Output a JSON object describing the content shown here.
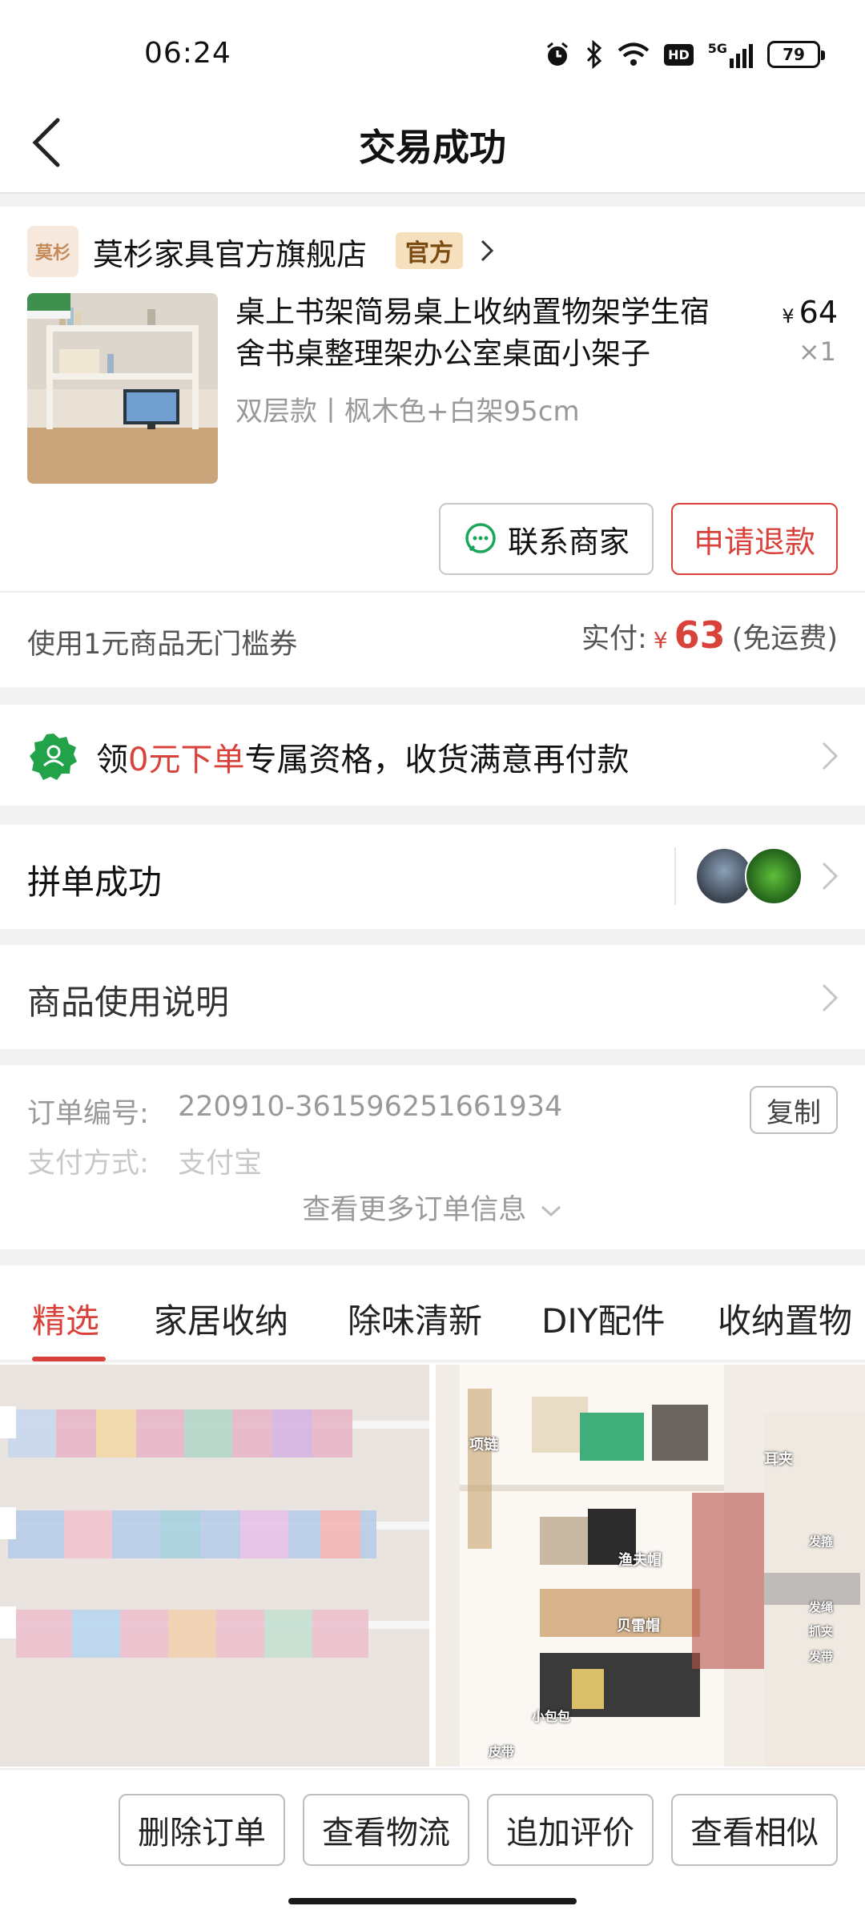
{
  "status_bar": {
    "time": "06:24",
    "battery": "79",
    "network": "5G",
    "hd": "HD"
  },
  "header": {
    "title": "交易成功"
  },
  "shop": {
    "logo_text": "莫杉",
    "name": "莫杉家具官方旗舰店",
    "badge": "官方"
  },
  "product": {
    "title": "桌上书架简易桌上收纳置物架学生宿舍书桌整理架办公室桌面小架子",
    "spec": "双层款丨枫木色+白架95cm",
    "currency": "¥",
    "price": "64",
    "qty": "×1"
  },
  "actions": {
    "contact": "联系商家",
    "refund": "申请退款"
  },
  "payment": {
    "coupon": "使用1元商品无门槛券",
    "paid_label": "实付:",
    "currency": "¥",
    "amount": "63",
    "shipping": "(免运费)"
  },
  "promo": {
    "prefix": "领",
    "highlight": "0元下单",
    "suffix": "专属资格，收货满意再付款"
  },
  "group": {
    "label": "拼单成功"
  },
  "manual": {
    "label": "商品使用说明"
  },
  "order_info": {
    "order_no_label": "订单编号:",
    "order_no": "220910-361596251661934",
    "copy": "复制",
    "pay_method_label": "支付方式:",
    "pay_method": "支付宝",
    "more": "查看更多订单信息"
  },
  "tabs": [
    "精选",
    "家居收纳",
    "除味清新",
    "DIY配件",
    "收纳置物"
  ],
  "feed_labels": [
    "项链",
    "耳夹",
    "渔夫帽",
    "发箍",
    "贝雷帽",
    "发绳",
    "抓夹",
    "发带",
    "小包包",
    "皮带"
  ],
  "bottom_actions": [
    "删除订单",
    "查看物流",
    "追加评价",
    "查看相似"
  ],
  "colors": {
    "accent": "#d9423a",
    "badge_bg": "#f6dfbd",
    "promo_green": "#22a34a"
  }
}
